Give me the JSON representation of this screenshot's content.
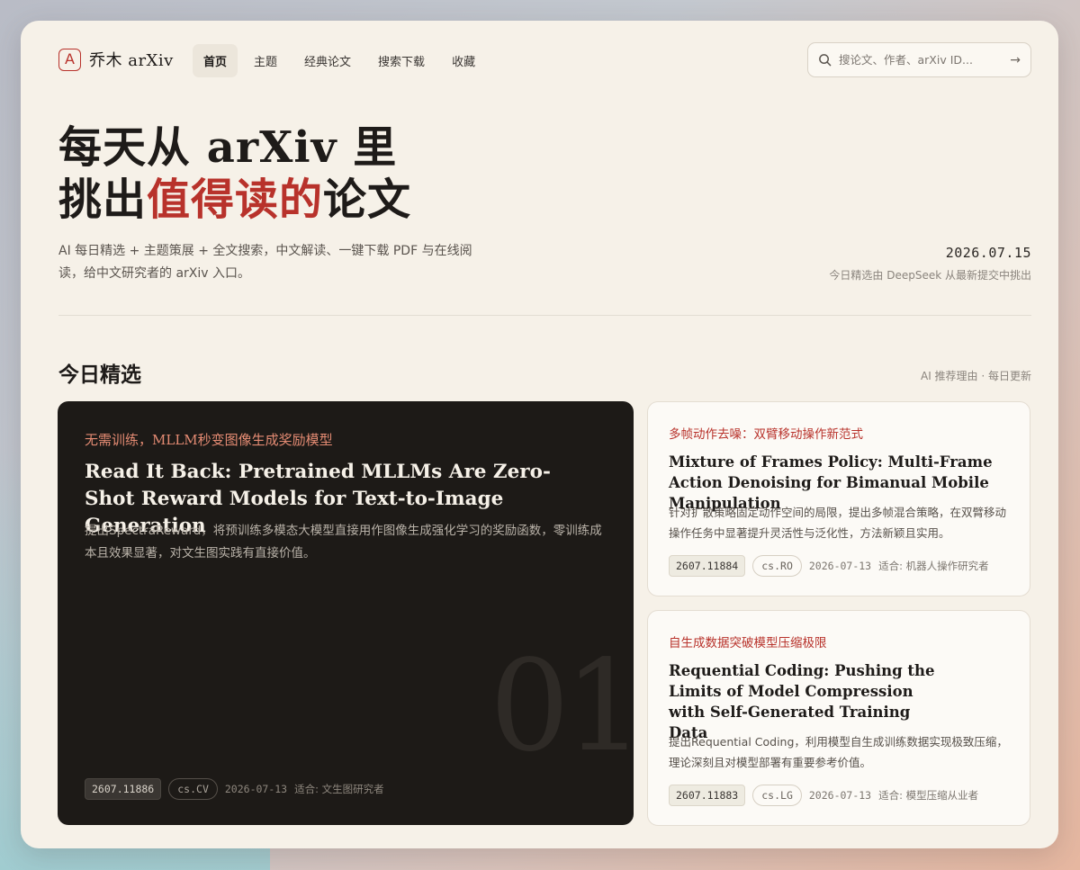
{
  "brand": {
    "logo_letter": "A",
    "name": "乔木 arXiv"
  },
  "nav": [
    {
      "label": "首页",
      "active": true
    },
    {
      "label": "主题",
      "active": false
    },
    {
      "label": "经典论文",
      "active": false
    },
    {
      "label": "搜索下载",
      "active": false
    },
    {
      "label": "收藏",
      "active": false
    }
  ],
  "search": {
    "placeholder": "搜论文、作者、arXiv ID...",
    "submit_icon": "arrow-right-icon"
  },
  "hero": {
    "line1_a": "每天从 ",
    "line1_b": "arXiv",
    "line1_c": " 里",
    "line2_a": "挑出",
    "line2_highlight": "值得读的",
    "line2_b": "论文",
    "subtitle": "AI 每日精选 + 主题策展 + 全文搜索，中文解读、一键下载 PDF 与在线阅读，给中文研究者的 arXiv 入口。",
    "date": "2026.07.15",
    "date_note": "今日精选由 DeepSeek 从最新提交中挑出"
  },
  "section": {
    "title": "今日精选",
    "note": "AI 推荐理由 · 每日更新"
  },
  "featured": {
    "tagline": "无需训练，MLLM秒变图像生成奖励模型",
    "title": "Read It Back: Pretrained MLLMs Are Zero-Shot Reward Models for Text-to-Image Generation",
    "desc": "提出SpectraReward，将预训练多模态大模型直接用作图像生成强化学习的奖励函数，零训练成本且效果显著，对文生图实践有直接价值。",
    "rank": "01",
    "arxiv_id": "2607.11886",
    "category": "cs.CV",
    "date": "2026-07-13",
    "audience": "适合: 文生图研究者"
  },
  "cards": [
    {
      "tagline": "多帧动作去噪：双臂移动操作新范式",
      "title": "Mixture of Frames Policy: Multi-Frame Action Denoising for Bimanual Mobile Manipulation",
      "desc": "针对扩散策略固定动作空间的局限，提出多帧混合策略，在双臂移动操作任务中显著提升灵活性与泛化性，方法新颖且实用。",
      "arxiv_id": "2607.11884",
      "category": "cs.RO",
      "date": "2026-07-13",
      "audience": "适合: 机器人操作研究者"
    },
    {
      "tagline": "自生成数据突破模型压缩极限",
      "title": "Requential Coding: Pushing the Limits of Model Compression with Self-Generated Training Data",
      "desc": "提出Requential Coding，利用模型自生成训练数据实现极致压缩，理论深刻且对模型部署有重要参考价值。",
      "arxiv_id": "2607.11883",
      "category": "cs.LG",
      "date": "2026-07-13",
      "audience": "适合: 模型压缩从业者"
    }
  ],
  "colors": {
    "accent": "#b8322b",
    "background": "#f6f1e8",
    "dark_card": "#1d1a17"
  }
}
